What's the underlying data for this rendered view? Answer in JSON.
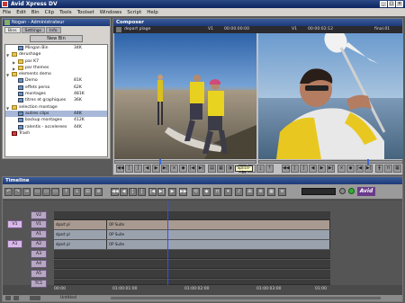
{
  "app": {
    "title": "Avid Xpress DV",
    "accent": "#1c3a78"
  },
  "menu": [
    "File",
    "Edit",
    "Bin",
    "Clip",
    "Tools",
    "Toolset",
    "Windows",
    "Script",
    "Help"
  ],
  "bin": {
    "title": "Nogan - Administrateur",
    "tabs": [
      "Bins",
      "Settings",
      "Info"
    ],
    "new_bin_label": "New Bin",
    "rows": [
      {
        "name": "Mingan Bin",
        "size": "34K",
        "level": 1,
        "kind": "bin"
      },
      {
        "name": "derushage",
        "size": "",
        "level": 0,
        "kind": "folder"
      },
      {
        "name": "par K7",
        "size": "",
        "level": 1,
        "kind": "folder"
      },
      {
        "name": "par themes",
        "size": "",
        "level": 1,
        "kind": "folder"
      },
      {
        "name": "elements demo",
        "size": "",
        "level": 0,
        "kind": "folder"
      },
      {
        "name": "Demo",
        "size": "81K",
        "level": 1,
        "kind": "bin"
      },
      {
        "name": "effets perso",
        "size": "62K",
        "level": 1,
        "kind": "bin"
      },
      {
        "name": "montages",
        "size": "481K",
        "level": 1,
        "kind": "bin"
      },
      {
        "name": "titres et graphiques",
        "size": "36K",
        "level": 1,
        "kind": "bin"
      },
      {
        "name": "selection montage",
        "size": "",
        "level": 0,
        "kind": "folder"
      },
      {
        "name": "autres clips",
        "size": "44K",
        "level": 1,
        "kind": "bin",
        "selected": true
      },
      {
        "name": "backup montages",
        "size": "412K",
        "level": 1,
        "kind": "bin"
      },
      {
        "name": "ralentis - accelerees",
        "size": "44K",
        "level": 1,
        "kind": "bin"
      },
      {
        "name": "Trash",
        "size": "",
        "level": 0,
        "kind": "trash"
      }
    ]
  },
  "composer": {
    "title": "Composer",
    "source_name": "depart plage",
    "source_track": "V1",
    "source_tc": "00:00:00:00",
    "record_track": "V1",
    "record_tc": "00:00:02:12",
    "record_name": "final.01",
    "tooltip": "Splice-in"
  },
  "timeline": {
    "title": "Timeline",
    "brand": "Avid",
    "tracks": [
      "V2",
      "V1",
      "A1",
      "A2",
      "A3",
      "A4",
      "A5",
      "TC1"
    ],
    "source_tracks": [
      "V1",
      "A1"
    ],
    "clips": {
      "V1": [
        "dpart pl",
        "OP Suite"
      ],
      "A1": [
        "dpart pl",
        "OP Suite"
      ],
      "A2": [
        "dpart pl",
        "OP Suite"
      ]
    },
    "ruler": [
      "00:00",
      "01:00:01:00",
      "01:00:02:00",
      "01:00:03:00",
      "01:00"
    ],
    "status": "Untitled"
  }
}
